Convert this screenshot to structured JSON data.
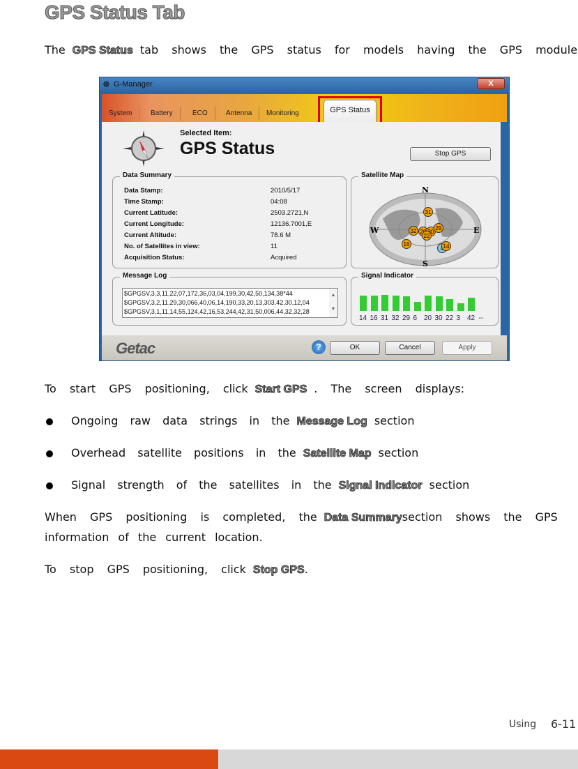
{
  "heading": "GPS Status Tab",
  "intro": {
    "pre": "The",
    "kw": "GPS Status",
    "post": "tab shows the GPS status for models having the GPS module."
  },
  "window": {
    "title": "G-Manager",
    "close": "X",
    "tabs": [
      "System",
      "Battery",
      "ECO",
      "Antenna",
      "Monitoring",
      "GPS Status"
    ],
    "active_tab": "GPS Status",
    "selected_item_label": "Selected Item:",
    "selected_item": "GPS Status",
    "stop_gps": "Stop GPS",
    "data_summary": {
      "title": "Data Summary",
      "rows": [
        {
          "label": "Data Stamp:",
          "value": "2010/5/17"
        },
        {
          "label": "Time Stamp:",
          "value": "04:08"
        },
        {
          "label": "Current Latitude:",
          "value": "2503.2721,N"
        },
        {
          "label": "Current Longitude:",
          "value": "12136.7001,E"
        },
        {
          "label": "Current Altitude:",
          "value": "78.6 M"
        },
        {
          "label": "No. of Satellites in view:",
          "value": "11"
        },
        {
          "label": "Acquisition Status:",
          "value": "Acquired"
        }
      ]
    },
    "message_log": {
      "title": "Message Log",
      "lines": [
        "$GPGSV,3,3,11,22,07,172,36,03,04,199,30,42,50,134,38*44",
        "$GPGSV,3,2,11,29,30,066,40,06,14,190,33,20,13,303,42,30,12,04",
        "$GPGSV,3,1,11,14,55,124,42,16,53,244,42,31,50,006,44,32,32,28"
      ]
    },
    "satellite_map": {
      "title": "Satellite Map",
      "compass": [
        "N",
        "E",
        "S",
        "W"
      ],
      "satellites": [
        "31",
        "32",
        "20",
        "30",
        "29",
        "22",
        "16",
        "4",
        "14"
      ],
      "colors": {
        "tracked": "#f5a000",
        "other": "#7ec8e8"
      }
    },
    "signal_indicator": {
      "title": "Signal Indicator",
      "color": "#33cc33",
      "bars": [
        {
          "id": "14",
          "level": 92
        },
        {
          "id": "16",
          "level": 92
        },
        {
          "id": "31",
          "level": 96
        },
        {
          "id": "32",
          "level": 92
        },
        {
          "id": "29",
          "level": 86
        },
        {
          "id": "6",
          "level": 56
        },
        {
          "id": "20",
          "level": 92
        },
        {
          "id": "30",
          "level": 88
        },
        {
          "id": "22",
          "level": 70
        },
        {
          "id": "3",
          "level": 44
        },
        {
          "id": "42",
          "level": 78
        }
      ],
      "empty": "--"
    },
    "logo": "Getac",
    "help": "?",
    "ok": "OK",
    "cancel": "Cancel",
    "apply": "Apply"
  },
  "p1": {
    "pre": "To start GPS positioning, click",
    "kw": "Start GPS",
    "post": ". The screen displays:"
  },
  "bullets": [
    {
      "pre": "Ongoing raw data strings in the",
      "kw": "Message Log",
      "post": "section"
    },
    {
      "pre": "Overhead satellite positions in the",
      "kw": "Satellite Map",
      "post": "section"
    },
    {
      "pre": "Signal strength of the satellites in the",
      "kw": "Signal Indicator",
      "post": "section"
    }
  ],
  "p2": {
    "pre": "When GPS positioning is completed, the",
    "kw": "Data Summary",
    "post": "section shows the GPS",
    "line2": "information of the current location."
  },
  "p3": {
    "pre": "To stop GPS positioning, click",
    "kw": "Stop GPS",
    "post": "."
  },
  "footer": {
    "section": "Using",
    "page": "6-11",
    "colors": {
      "accent": "#d84a12",
      "bar": "#d8d8d8"
    }
  }
}
